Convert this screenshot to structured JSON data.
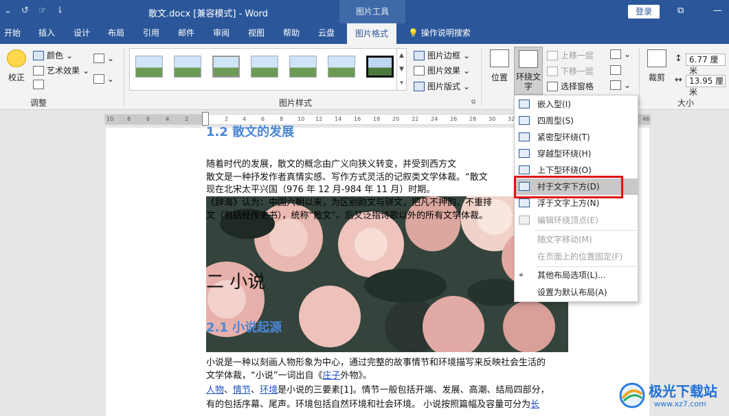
{
  "titlebar": {
    "title": "散文.docx [兼容模式]  -  Word",
    "contextual_tab": "图片工具",
    "login": "登录"
  },
  "tabs": [
    "开始",
    "插入",
    "设计",
    "布局",
    "引用",
    "邮件",
    "审阅",
    "视图",
    "帮助",
    "云盘",
    "图片格式"
  ],
  "tell_me": "操作说明搜索",
  "ribbon": {
    "adjust": {
      "correct": "校正",
      "color": "颜色",
      "artistic": "艺术效果",
      "label": "调整"
    },
    "styles": {
      "border": "图片边框",
      "effect": "图片效果",
      "layout": "图片版式",
      "label": "图片样式"
    },
    "arrange": {
      "position": "位置",
      "wrap": "环绕文字",
      "bring_forward": "上移一层",
      "send_backward": "下移一层",
      "selection_pane": "选择窗格"
    },
    "size": {
      "crop": "裁剪",
      "height": "6.77 厘米",
      "width": "13.95 厘米",
      "label": "大小"
    }
  },
  "ruler_numbers": [
    "10",
    "8",
    "6",
    "4",
    "2",
    "2",
    "4",
    "6",
    "8",
    "10",
    "12",
    "14",
    "16",
    "18",
    "20",
    "22",
    "24",
    "26",
    "28",
    "30",
    "32",
    "46"
  ],
  "doc": {
    "heading1": "1.2 散文的发展",
    "p1_line1": "随着时代的发展，散文的概念由广义向狭义转变，并受到西方文",
    "p1_line2": "散文是一种抒发作者真情实感、写作方式灵活的记叙类文学体裁。“散文",
    "p1_line3": "现在北宋太平兴国（976 年 12 月-984 年 11 月）时期。",
    "p2_line1": "《辞海》认为：中国六朝以来，为区别韵文与骈文，把凡不押韵、不重排",
    "p2_line2": "文（包括经传史书），统称“散文”。后又泛指诗歌以外的所有文学体裁。",
    "heading_big": "二 小说",
    "heading2": "2.1 小说起源",
    "p3_line1": "小说是一种以刻画人物形象为中心，通过完整的故事情节和环境描写来反映社会生活的",
    "p3_line2_a": "文学体裁，“小说”一词出自《",
    "p3_line2_link": "庄子",
    "p3_line2_b": "外物》。",
    "p4_link1": "人物",
    "p4_sep1": "、",
    "p4_link2": "情节",
    "p4_sep2": "、",
    "p4_link3": "环境",
    "p4_rest": "是小说的三要素[1]。情节一般包括开端、发展、高潮、结局四部分，",
    "p5_text": "有的包括序幕、尾声。环境包括自然环境和社会环境。 小说按照篇幅及容量可分为",
    "p5_link": "长"
  },
  "wrap_menu": {
    "items": [
      {
        "label": "嵌入型(I)",
        "enabled": true
      },
      {
        "label": "四周型(S)",
        "enabled": true
      },
      {
        "label": "紧密型环绕(T)",
        "enabled": true
      },
      {
        "label": "穿越型环绕(H)",
        "enabled": true
      },
      {
        "label": "上下型环绕(O)",
        "enabled": true
      },
      {
        "label": "衬于文字下方(D)",
        "enabled": true,
        "highlighted": true
      },
      {
        "label": "浮于文字上方(N)",
        "enabled": true
      },
      {
        "label": "编辑环绕顶点(E)",
        "enabled": false
      },
      {
        "label": "随文字移动(M)",
        "enabled": false
      },
      {
        "label": "在页面上的位置固定(F)",
        "enabled": false
      },
      {
        "label": "其他布局选项(L)...",
        "enabled": true
      },
      {
        "label": "设置为默认布局(A)",
        "enabled": true
      }
    ]
  },
  "watermark": {
    "brand": "极光下载站",
    "url": "www.xz7.com"
  }
}
